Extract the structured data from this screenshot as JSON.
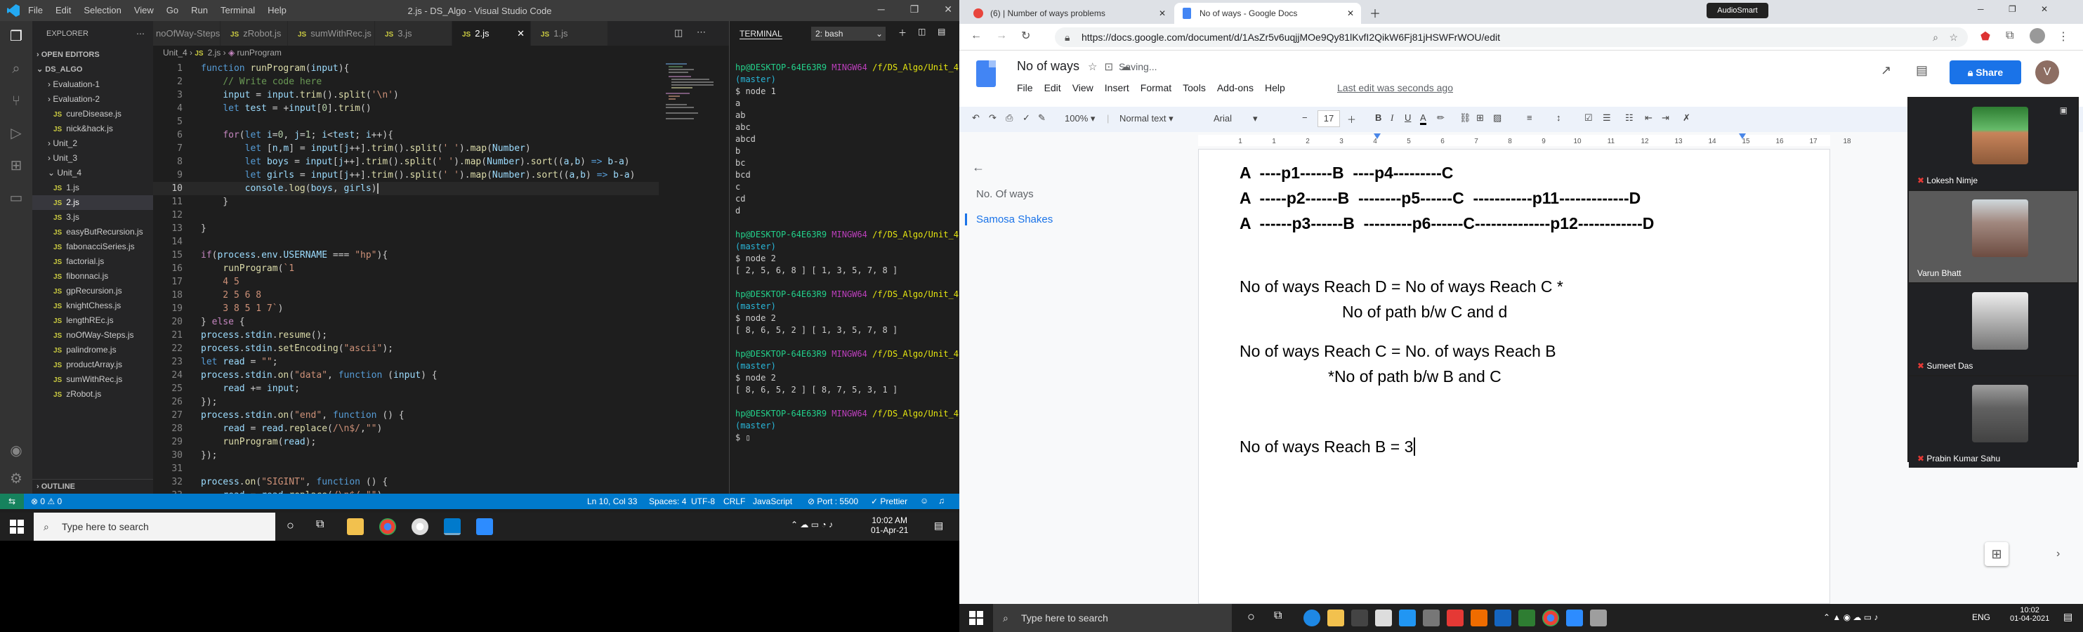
{
  "vscode": {
    "menu": [
      "File",
      "Edit",
      "Selection",
      "View",
      "Go",
      "Run",
      "Terminal",
      "Help"
    ],
    "window_title": "2.js - DS_Algo - Visual Studio Code",
    "explorer_label": "EXPLORER",
    "open_editors_label": "OPEN EDITORS",
    "folder_label": "DS_ALGO",
    "tree": [
      "Evaluation-1",
      "Evaluation-2",
      "cureDisease.js",
      "nick&hack.js",
      "Unit_2",
      "Unit_3",
      "Unit_4",
      "1.js",
      "2.js",
      "3.js",
      "easyButRecursion.js",
      "fabonacciSeries.js",
      "factorial.js",
      "fibonnaci.js",
      "gpRecursion.js",
      "knightChess.js",
      "lengthREc.js",
      "noOfWay-Steps.js",
      "palindrome.js",
      "productArray.js",
      "sumWithRec.js",
      "zRobot.js"
    ],
    "outline_label": "OUTLINE",
    "tabs": [
      "noOfWay-Steps.js",
      "zRobot.js",
      "sumWithRec.js",
      "3.js",
      "2.js",
      "1.js"
    ],
    "breadcrumb": [
      "Unit_4",
      "2.js",
      "runProgram"
    ],
    "line_numbers": [
      "1",
      "2",
      "3",
      "4",
      "5",
      "6",
      "7",
      "8",
      "9",
      "10",
      "11",
      "12",
      "13",
      "14",
      "15",
      "16",
      "17",
      "18",
      "19",
      "20",
      "21",
      "22",
      "23",
      "24",
      "25",
      "26",
      "27",
      "28",
      "29",
      "30",
      "31",
      "32",
      "33"
    ],
    "terminal_tab": "TERMINAL",
    "terminal_select": "2: bash",
    "terminal_prompt": "hp@DESKTOP-64E63R9",
    "terminal_shell": "MINGW64",
    "terminal_path": "/f/DS_Algo/Unit_4",
    "terminal_branch": "(master)",
    "terminal_runs": [
      {
        "cmd": "$ node 1",
        "output": [
          "a",
          "ab",
          "abc",
          "abcd",
          "b",
          "bc",
          "bcd",
          "c",
          "cd",
          "d"
        ]
      },
      {
        "cmd": "$ node 2",
        "output": [
          "[ 2, 5, 6, 8 ] [ 1, 3, 5, 7, 8 ]"
        ]
      },
      {
        "cmd": "$ node 2",
        "output": [
          "[ 8, 6, 5, 2 ] [ 1, 3, 5, 7, 8 ]"
        ]
      },
      {
        "cmd": "$ node 2",
        "output": [
          "[ 8, 6, 5, 2 ] [ 8, 7, 5, 3, 1 ]"
        ]
      },
      {
        "cmd": "$",
        "output": []
      }
    ],
    "status": {
      "errors": "⊗ 0 ⚠ 0",
      "position": "Ln 10, Col 33",
      "spaces": "Spaces: 4",
      "encoding": "UTF-8",
      "eol": "CRLF",
      "language": "JavaScript",
      "port": "⊘ Port : 5500",
      "prettier": "✓ Prettier"
    }
  },
  "taskbar_left": {
    "search": "Type here to search",
    "time": "10:02 AM",
    "date": "01-Apr-21"
  },
  "chrome": {
    "tab1": "(6) | Number of ways problems",
    "tab2": "No of ways - Google Docs",
    "url": "https://docs.google.com/document/d/1AsZr5v6uqjjMOe9Qy81lKvfI2QikW6Fj81jHSWFrWOU/edit",
    "extension": "AudioSmart"
  },
  "docs": {
    "title": "No of ways",
    "saving": "Saving...",
    "menus": [
      "File",
      "Edit",
      "View",
      "Insert",
      "Format",
      "Tools",
      "Add-ons",
      "Help"
    ],
    "last_edit": "Last edit was seconds ago",
    "share": "Share",
    "avatar": "V",
    "zoom": "100%",
    "style": "Normal text",
    "font": "Arial",
    "font_size": "17",
    "outline": [
      "No. Of ways",
      "Samosa Shakes"
    ],
    "lines": [
      "A  ----p1------B  ----p4---------C",
      "A  -----p2------B  --------p5------C  -----------p11-------------D",
      "A  ------p3------B  ---------p6------C--------------p12------------D",
      "No of ways Reach D = No of ways Reach C *",
      "No of path b/w C and d",
      "No of ways Reach C = No. of ways Reach B",
      "*No of path b/w B and C",
      "No of ways Reach B = 3"
    ]
  },
  "meet": {
    "participants": [
      "Lokesh Nimje",
      "Varun Bhatt",
      "Sumeet Das",
      "Prabin Kumar Sahu"
    ]
  },
  "taskbar_right": {
    "search": "Type here to search",
    "time": "10:02",
    "date": "01-04-2021",
    "lang": "ENG"
  }
}
